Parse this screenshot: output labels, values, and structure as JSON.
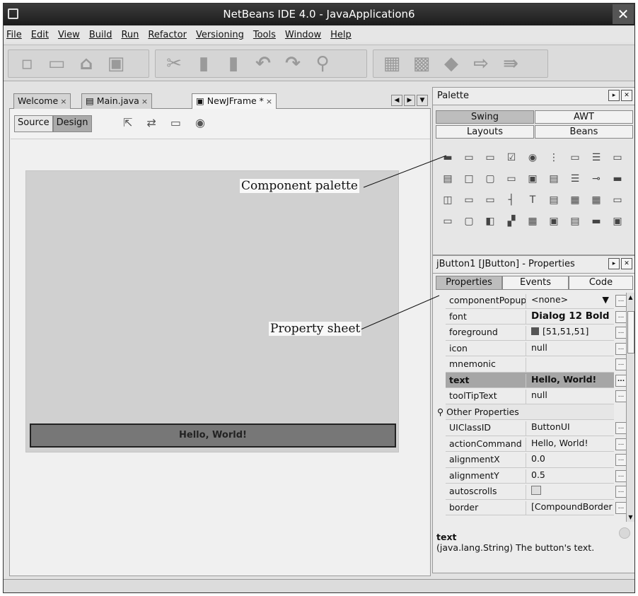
{
  "window": {
    "title": "NetBeans IDE 4.0 - JavaApplication6",
    "close": "✕"
  },
  "menu": [
    "File",
    "Edit",
    "View",
    "Build",
    "Run",
    "Refactor",
    "Versioning",
    "Tools",
    "Window",
    "Help"
  ],
  "toolbar": {
    "icons": [
      "new-project-icon",
      "new-file-icon",
      "open-icon",
      "save-all-icon",
      "cut-icon",
      "copy-icon",
      "paste-icon",
      "undo-icon",
      "redo-icon",
      "find-icon",
      "build-icon",
      "clean-build-icon",
      "run-icon",
      "debug-icon",
      "step-icon"
    ]
  },
  "editor": {
    "tabs": [
      {
        "label": "Welcome"
      },
      {
        "label": "Main.java"
      },
      {
        "label": "NewJFrame *"
      }
    ],
    "source_btn": "Source",
    "design_btn": "Design",
    "button_text": "Hello, World!"
  },
  "palette": {
    "title": "Palette",
    "tabs": [
      "Swing",
      "AWT",
      "Layouts",
      "Beans"
    ]
  },
  "properties": {
    "title": "jButton1 [JButton] - Properties",
    "tabs": [
      "Properties",
      "Events",
      "Code"
    ],
    "rows": [
      {
        "name": "componentPopupMenu",
        "value": "<none>"
      },
      {
        "name": "font",
        "value": "Dialog 12 Bold"
      },
      {
        "name": "foreground",
        "value": "[51,51,51]"
      },
      {
        "name": "icon",
        "value": "null"
      },
      {
        "name": "mnemonic",
        "value": ""
      },
      {
        "name": "text",
        "value": "Hello, World!"
      },
      {
        "name": "toolTipText",
        "value": "null"
      },
      {
        "name": "Other Properties",
        "value": ""
      },
      {
        "name": "UIClassID",
        "value": "ButtonUI"
      },
      {
        "name": "actionCommand",
        "value": "Hello, World!"
      },
      {
        "name": "alignmentX",
        "value": "0.0"
      },
      {
        "name": "alignmentY",
        "value": "0.5"
      },
      {
        "name": "autoscrolls",
        "value": ""
      },
      {
        "name": "border",
        "value": "[CompoundBorder]"
      }
    ],
    "desc_title": "text",
    "desc_body": "(java.lang.String)  The button's text."
  },
  "callouts": {
    "palette": "Component palette",
    "property_sheet": "Property sheet"
  },
  "colors": {
    "foreground_swatch": "#555555",
    "titlebar": "#2a2a2a",
    "selected_row": "#a6a6a6"
  }
}
